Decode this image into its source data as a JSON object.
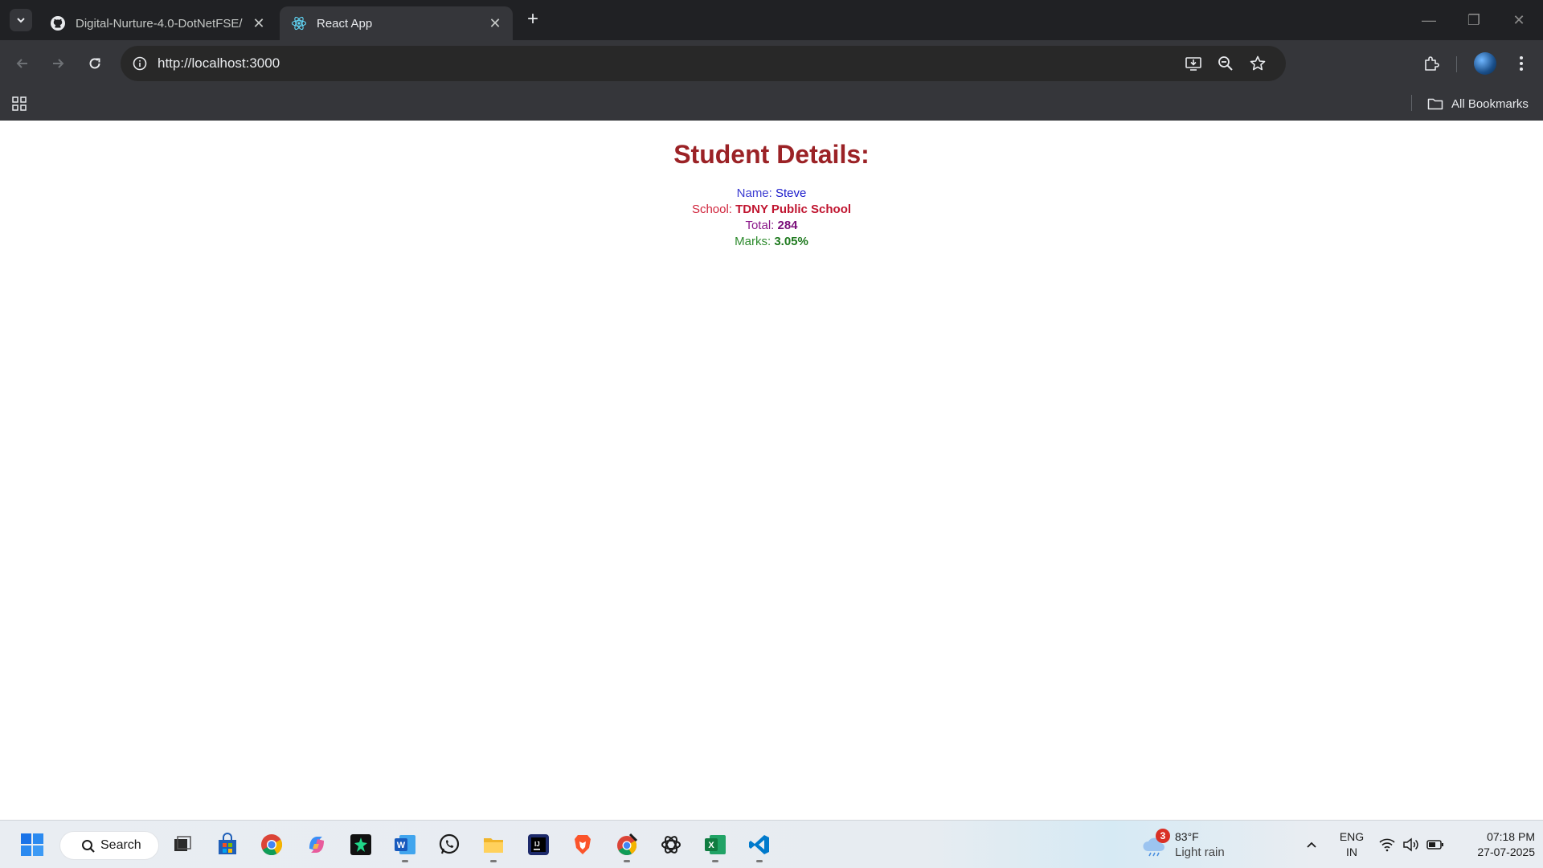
{
  "browser": {
    "tabs": [
      {
        "title": "Digital-Nurture-4.0-DotNetFSE/",
        "icon": "github-icon",
        "active": false
      },
      {
        "title": "React App",
        "icon": "react-icon",
        "active": true
      }
    ],
    "new_tab": "+",
    "url": "http://localhost:3000",
    "bookmarks_label": "All Bookmarks"
  },
  "page": {
    "heading": "Student Details:",
    "rows": [
      {
        "label": "Name: ",
        "value": "Steve"
      },
      {
        "label": "School: ",
        "value": "TDNY Public School"
      },
      {
        "label": "Total: ",
        "value": "284"
      },
      {
        "label": "Marks: ",
        "value": "3.05%"
      }
    ]
  },
  "taskbar": {
    "search_label": "Search",
    "apps": [
      "task-view-icon",
      "microsoft-store-icon",
      "chrome-icon",
      "copilot-icon",
      "jetbrains-app-icon",
      "word-icon",
      "whatsapp-icon",
      "file-explorer-icon",
      "intellij-icon",
      "brave-icon",
      "chrome-dev-icon",
      "chatgpt-icon",
      "excel-icon",
      "vscode-icon"
    ],
    "weather": {
      "badge": "3",
      "temp": "83°F",
      "desc": "Light rain"
    },
    "lang": {
      "line1": "ENG",
      "line2": "IN"
    },
    "clock": {
      "time": "07:18 PM",
      "date": "27-07-2025"
    }
  },
  "colors": {
    "heading": "#9b2226",
    "name": "#1a1acb",
    "school": "#c01530",
    "total": "#7a0f7a",
    "marks": "#1f7a1f"
  }
}
